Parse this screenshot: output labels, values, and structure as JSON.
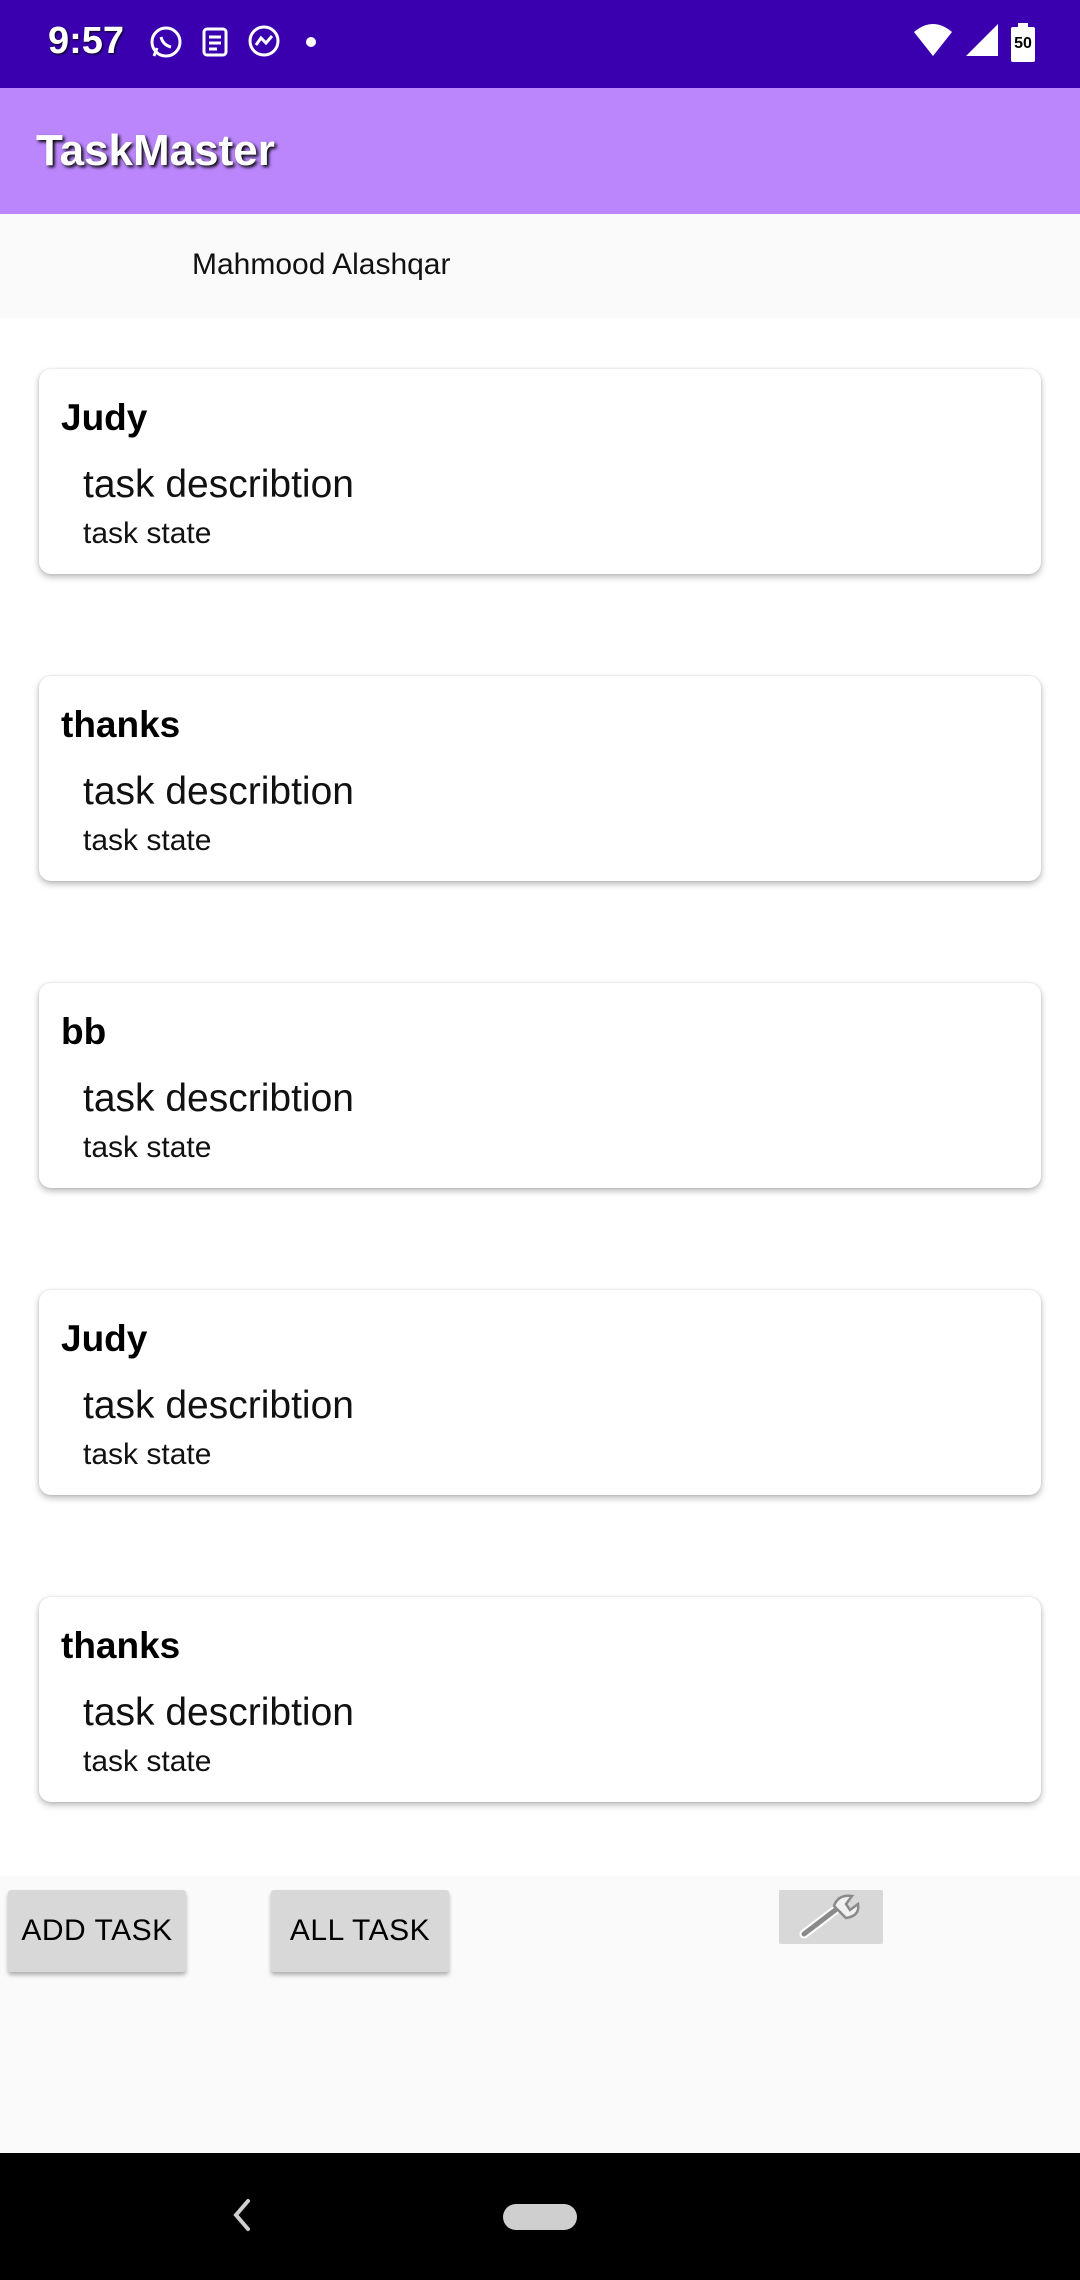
{
  "status_bar": {
    "time": "9:57",
    "left_icons": [
      "whatsapp-icon",
      "news-icon",
      "messenger-icon",
      "dot-icon"
    ],
    "right_icons": [
      "wifi-icon",
      "signal-icon",
      "battery-icon"
    ],
    "battery_level": "50",
    "bg_color": "#3a00b0"
  },
  "app_bar": {
    "title": "TaskMaster",
    "bg_color": "#bb86fc"
  },
  "user": {
    "name": "Mahmood Alashqar"
  },
  "tasks": [
    {
      "title": "Judy",
      "description": "task describtion",
      "state": "task state"
    },
    {
      "title": "thanks",
      "description": "task describtion",
      "state": "task state"
    },
    {
      "title": "bb",
      "description": "task describtion",
      "state": "task state"
    },
    {
      "title": "Judy",
      "description": "task describtion",
      "state": "task state"
    },
    {
      "title": "thanks",
      "description": "task describtion",
      "state": "task state"
    }
  ],
  "actions": {
    "add_task_label": "ADD TASK",
    "all_task_label": "ALL TASK",
    "settings_icon": "wrench-icon"
  },
  "nav_bar": {
    "icons": [
      "back-icon",
      "home-pill-icon"
    ]
  }
}
